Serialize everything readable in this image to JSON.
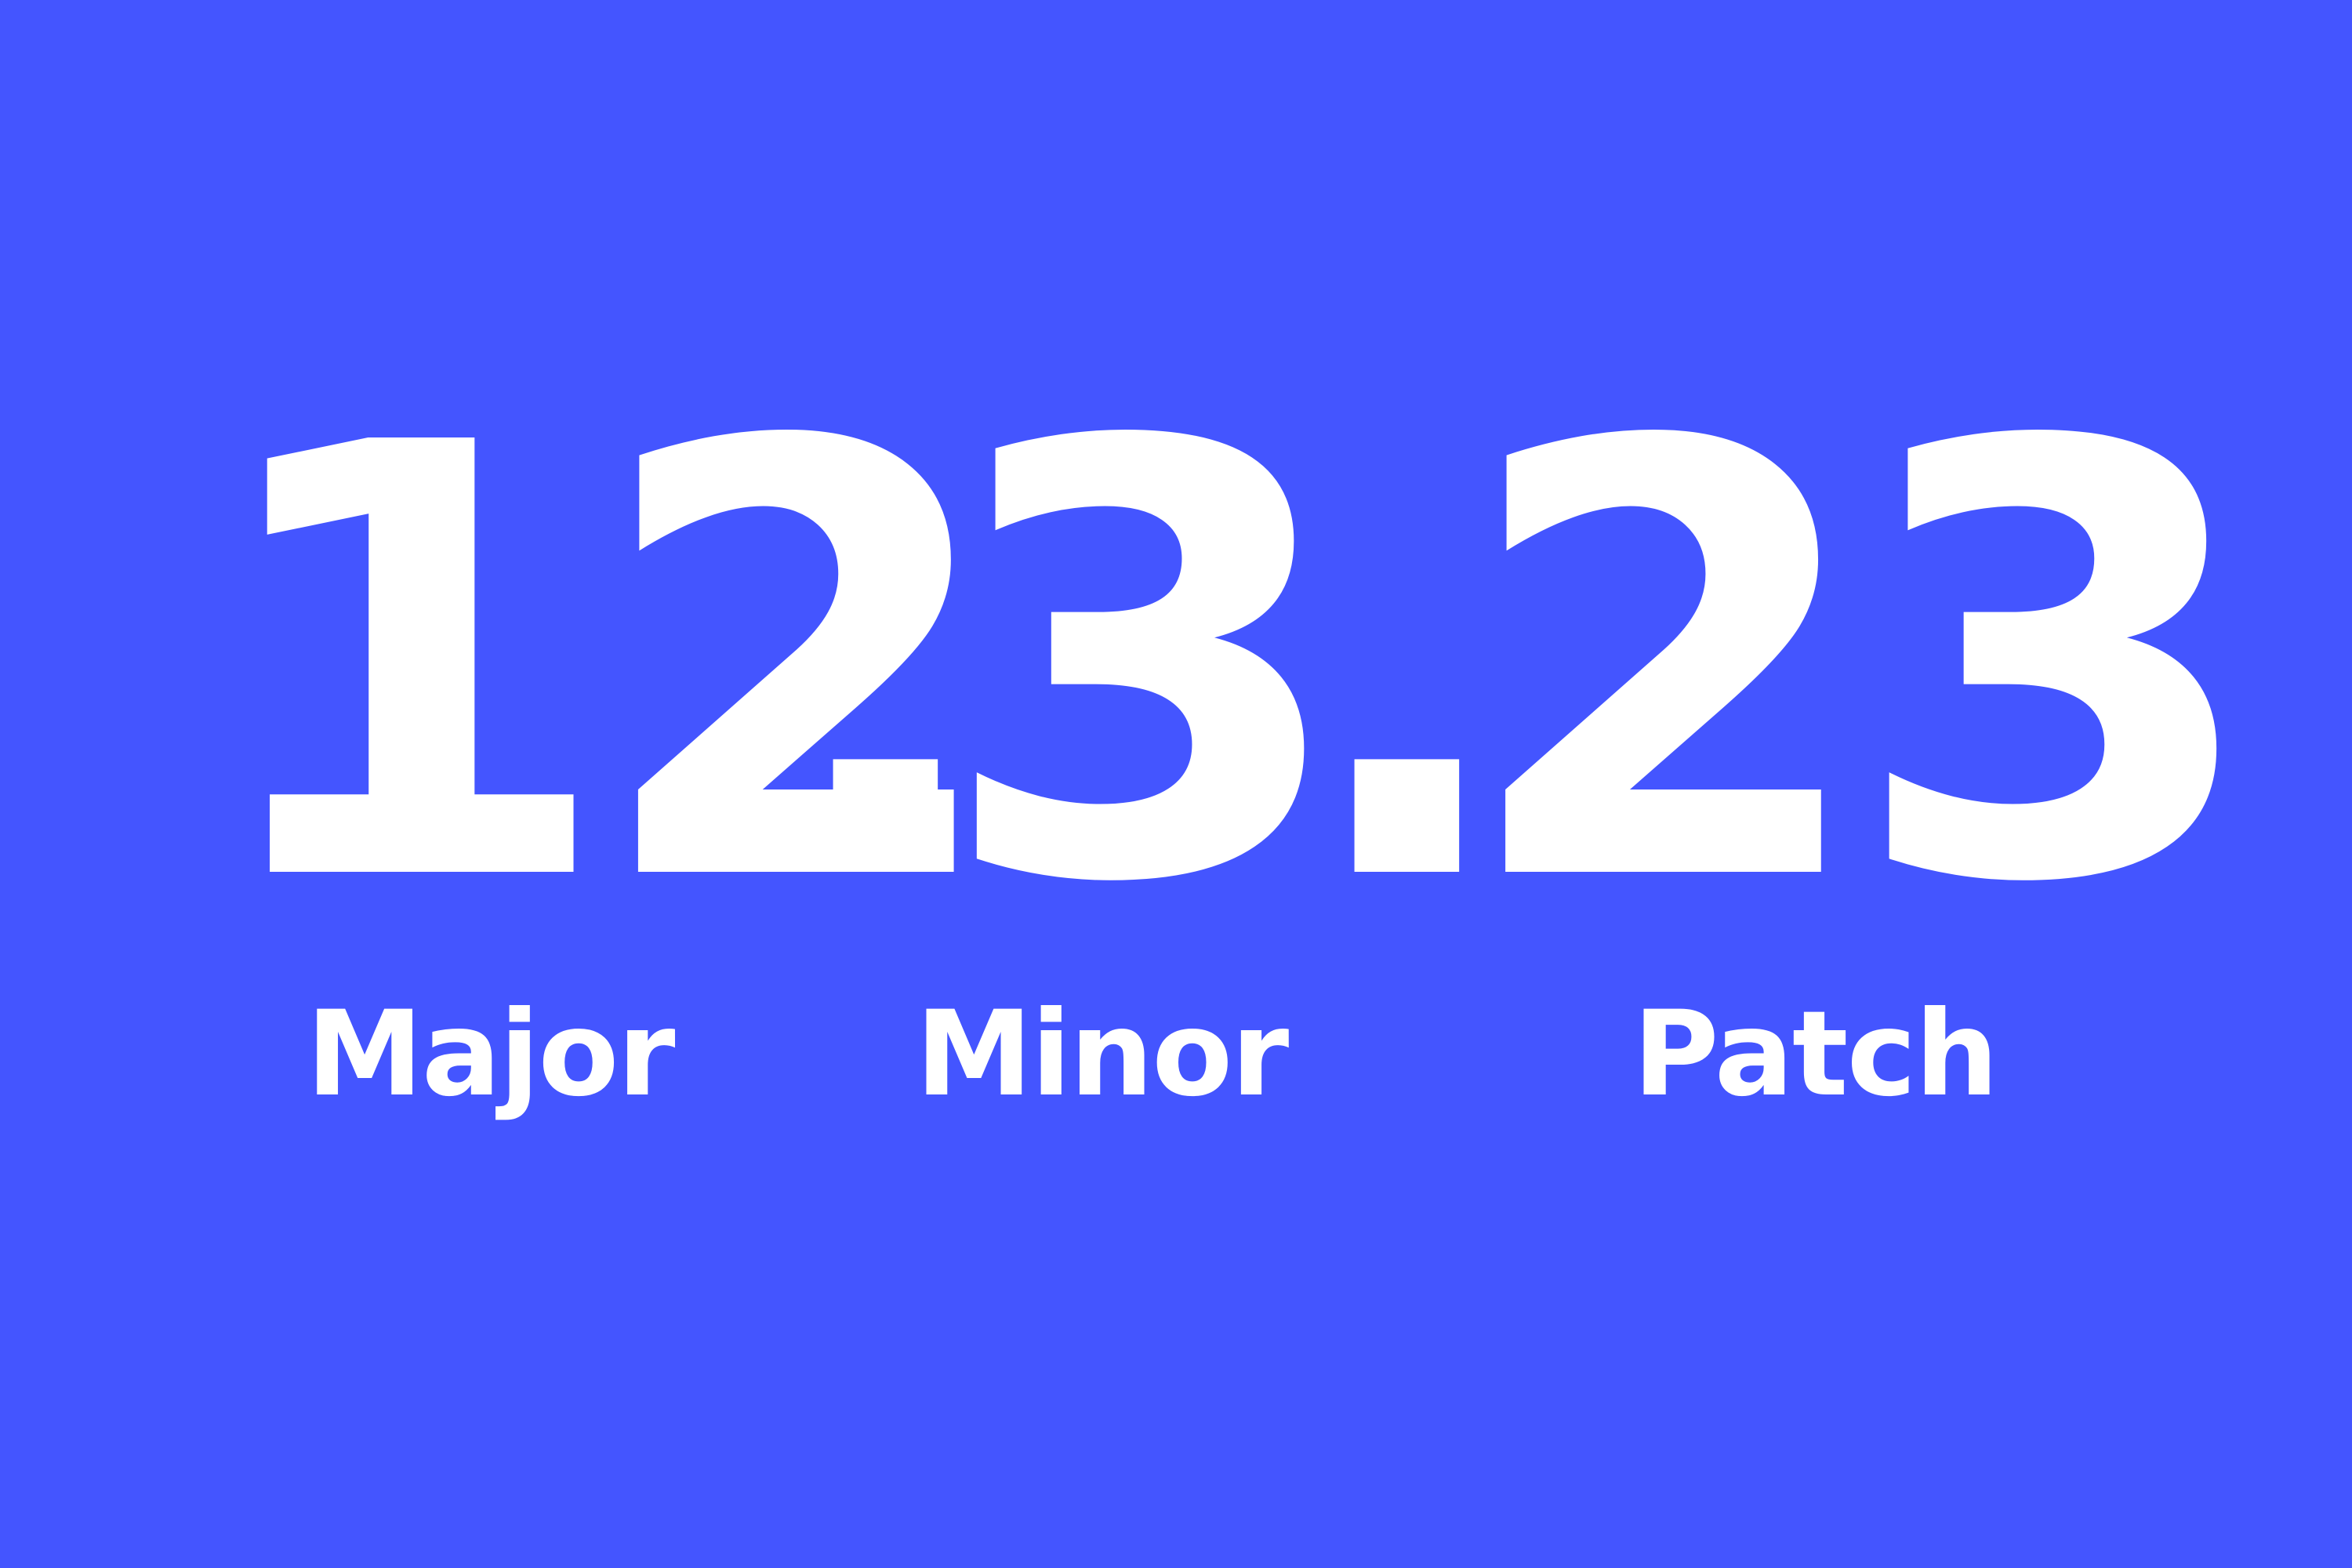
{
  "background_color": "#4455ff",
  "text_color": "#ffffff",
  "version": {
    "major": "12",
    "separator": ".",
    "minor": "3",
    "patch": "23"
  },
  "labels": {
    "major": "Major",
    "minor": "Minor",
    "patch": "Patch"
  }
}
